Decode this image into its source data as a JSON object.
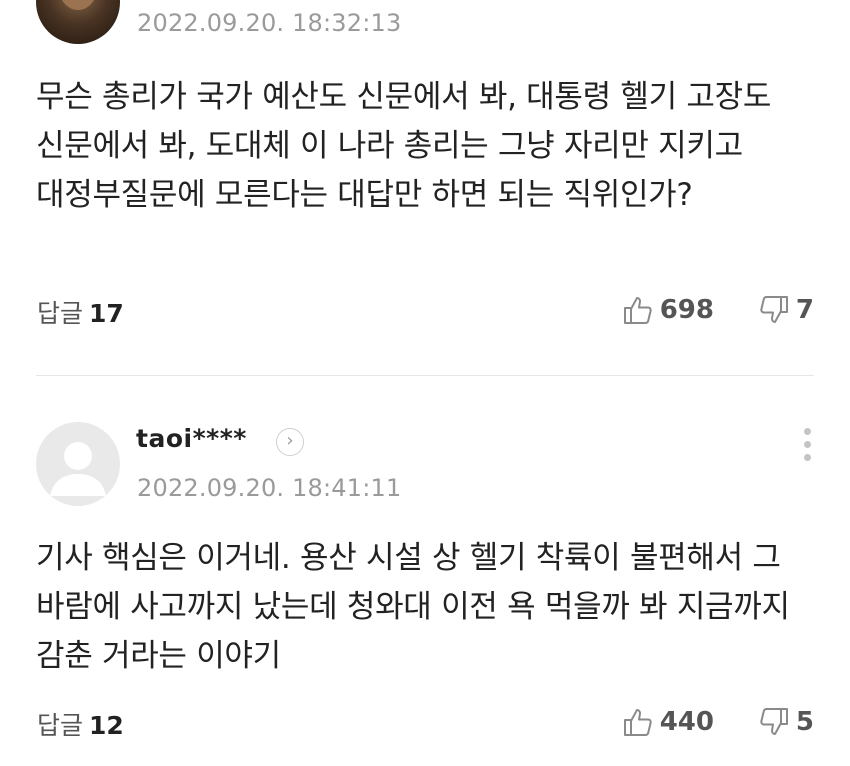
{
  "comments": [
    {
      "date": "2022.09.20. 18:32:13",
      "body": "무슨 총리가 국가 예산도 신문에서 봐, 대통령 헬기 고장도 신문에서 봐, 도대체 이 나라 총리는 그냥 자리만 지키고 대정부질문에 모른다는 대답만 하면 되는 직위인가?",
      "reply_label": "답글",
      "reply_count": "17",
      "likes": "698",
      "dislikes": "7"
    },
    {
      "nickname": "taoi****",
      "date": "2022.09.20. 18:41:11",
      "body": "기사 핵심은 이거네. 용산 시설 상 헬기 착륙이 불편해서 그 바람에 사고까지 났는데 청와대 이전 욕 먹을까 봐 지금까지 감춘 거라는 이야기",
      "reply_label": "답글",
      "reply_count": "12",
      "likes": "440",
      "dislikes": "5"
    }
  ],
  "icons": {
    "more": "more-vertical-icon",
    "profile_arrow": "chevron-right-icon",
    "like": "thumbs-up-icon",
    "dislike": "thumbs-down-icon"
  },
  "colors": {
    "text": "#222222",
    "meta": "#9a9a9a",
    "divider": "#e6e6e6"
  }
}
